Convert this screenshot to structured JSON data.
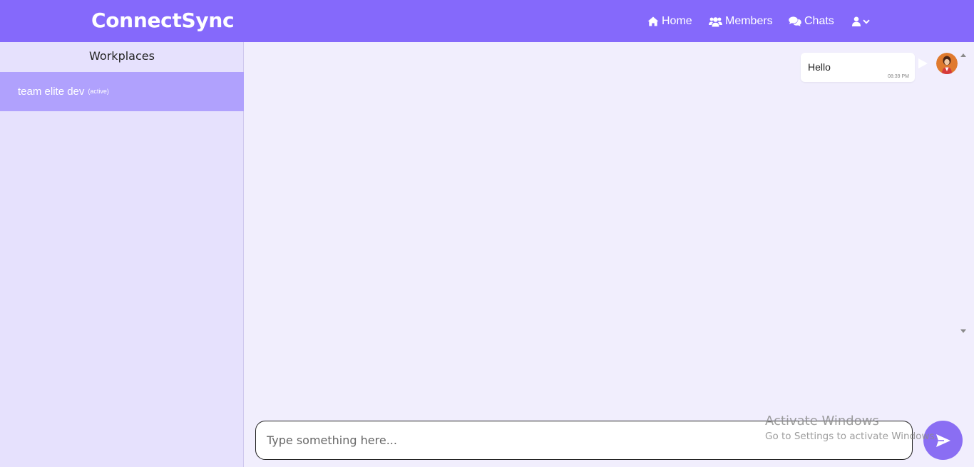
{
  "app": {
    "brand": "ConnectSync"
  },
  "nav": {
    "home_label": "Home",
    "members_label": "Members",
    "chats_label": "Chats"
  },
  "sidebar": {
    "title": "Workplaces",
    "items": [
      {
        "name": "team elite dev",
        "status": "(active)"
      }
    ]
  },
  "chat": {
    "messages": [
      {
        "text": "Hello",
        "time": "08:39 PM"
      }
    ]
  },
  "composer": {
    "placeholder": "Type something here...",
    "value": ""
  },
  "watermark": {
    "title": "Activate Windows",
    "subtitle": "Go to Settings to activate Windows."
  },
  "colors": {
    "navbar": "#8569fb",
    "sidebar": "#e6e1fd",
    "active_item": "#b0a1fd",
    "chat_background": "#f1eefd",
    "send_button": "#8a6ef3"
  },
  "icons": [
    "home-icon",
    "users-icon",
    "comments-icon",
    "user-icon",
    "chevron-down-icon",
    "send-icon"
  ]
}
